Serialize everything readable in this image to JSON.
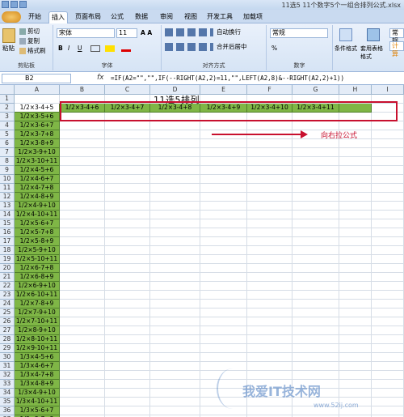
{
  "window": {
    "title": "11选5 11个数字5个一组合排列公式.xlsx"
  },
  "tabs": [
    "开始",
    "插入",
    "页面布局",
    "公式",
    "数据",
    "审阅",
    "视图",
    "开发工具",
    "加载项"
  ],
  "ribbon": {
    "clipboard": {
      "paste": "粘贴",
      "cut": "剪切",
      "copy": "复制",
      "format_painter": "格式刷",
      "label": "剪贴板"
    },
    "font": {
      "name": "宋体",
      "size": "11",
      "bold": "B",
      "italic": "I",
      "underline": "U",
      "label": "字体"
    },
    "align": {
      "wrap": "自动换行",
      "merge": "合并后居中",
      "label": "对齐方式"
    },
    "number": {
      "format": "常规",
      "percent": "%",
      "label": "数字"
    },
    "styles": {
      "conditional": "条件格式",
      "table": "套用表格格式",
      "cell_style": "常规",
      "calc": "计算"
    }
  },
  "formula_bar": {
    "cell_ref": "B2",
    "fx": "fx",
    "formula": "=IF(A2=\"\",\"\",IF(--RIGHT(A2,2)=11,\"\",LEFT(A2,8)&--RIGHT(A2,2)+1))"
  },
  "sheet": {
    "columns": [
      "A",
      "B",
      "C",
      "D",
      "E",
      "F",
      "G",
      "H",
      "I"
    ],
    "title": "11选5排列",
    "annotation": "向右拉公式",
    "row2": [
      "1/2×3-4+6",
      "1/2×3-4+7",
      "1/2×3-4+8",
      "1/2×3-4+9",
      "1/2×3-4+10",
      "1/2×3-4+11"
    ],
    "colA": [
      "1/2×3-4+5",
      "1/2×3-5+6",
      "1/2×3-6+7",
      "1/2×3-7+8",
      "1/2×3-8+9",
      "1/2×3-9+10",
      "1/2×3-10+11",
      "1/2×4-5+6",
      "1/2×4-6+7",
      "1/2×4-7+8",
      "1/2×4-8+9",
      "1/2×4-9+10",
      "1/2×4-10+11",
      "1/2×5-6+7",
      "1/2×5-7+8",
      "1/2×5-8+9",
      "1/2×5-9+10",
      "1/2×5-10+11",
      "1/2×6-7+8",
      "1/2×6-8+9",
      "1/2×6-9+10",
      "1/2×6-10+11",
      "1/2×7-8+9",
      "1/2×7-9+10",
      "1/2×7-10+11",
      "1/2×8-9+10",
      "1/2×8-10+11",
      "1/2×9-10+11",
      "1/3×4-5+6",
      "1/3×4-6+7",
      "1/3×4-7+8",
      "1/3×4-8+9",
      "1/3×4-9+10",
      "1/3×4-10+11",
      "1/3×5-6+7",
      "1/3×5-7+8",
      "1/3×5-8+9"
    ],
    "rows": [
      "1",
      "2",
      "3",
      "4",
      "5",
      "6",
      "7",
      "8",
      "9",
      "10",
      "11",
      "12",
      "13",
      "14",
      "15",
      "16",
      "17",
      "18",
      "19",
      "20",
      "21",
      "22",
      "23",
      "24",
      "25",
      "26",
      "27",
      "28",
      "29",
      "30",
      "31",
      "32",
      "33",
      "34",
      "35",
      "36",
      "37",
      "38"
    ]
  },
  "watermark": {
    "text": "我爱IT技术网",
    "url": "www.52ij.com"
  }
}
